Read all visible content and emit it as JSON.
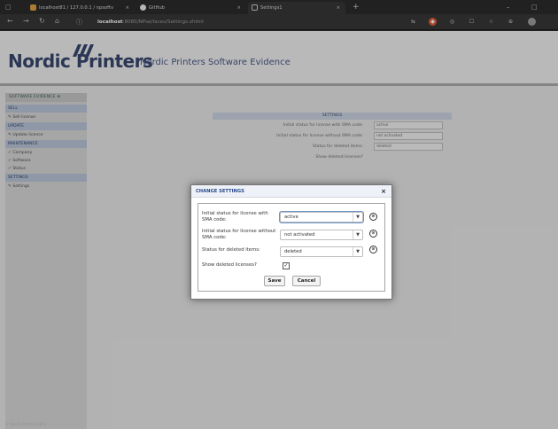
{
  "browser": {
    "tabs": [
      {
        "label": "localhost81 / 127.0.0.1 / npsoftv",
        "close": "×"
      },
      {
        "label": "GitHub",
        "close": "×"
      },
      {
        "label": "Settings1",
        "close": "×"
      }
    ],
    "new_tab": "+",
    "url_host": "localhost",
    "url_rest": ":8080/NPse/faces/Settings.xhtml",
    "controls": {
      "minimize": "–",
      "maximize": "□"
    }
  },
  "header": {
    "logo": "Nordic Printers",
    "app_title": "Nordic Printers Software Evidence"
  },
  "sidebar": {
    "toggle": "SOFTWARE EVIDENCE",
    "sections": [
      {
        "title": "SELL",
        "items": [
          "Sell license"
        ]
      },
      {
        "title": "UPDATE",
        "items": [
          "Update licence"
        ]
      },
      {
        "title": "MAINTENANCE",
        "items": [
          "Company",
          "Software",
          "Status"
        ]
      },
      {
        "title": "SETTINGS",
        "items": [
          "Settings"
        ]
      }
    ]
  },
  "background_form": {
    "title": "SETTINGS",
    "rows": [
      {
        "label": "Initial status for license with SMA code:",
        "value": "active"
      },
      {
        "label": "Initial status for license without SMA code:",
        "value": "not activated"
      },
      {
        "label": "Status for deleted items:",
        "value": "deleted"
      },
      {
        "label": "Show deleted licenses?",
        "value": ""
      }
    ]
  },
  "dialog": {
    "title": "CHANGE SETTINGS",
    "close": "×",
    "fields": [
      {
        "label": "Initial status for license with SMA code:",
        "value": "active"
      },
      {
        "label": "Initial status for license without SMA code:",
        "value": "not activated"
      },
      {
        "label": "Status for deleted items:",
        "value": "deleted"
      }
    ],
    "show_deleted_label": "Show deleted licenses?",
    "show_deleted_checked": true,
    "save_label": "Save",
    "cancel_label": "Cancel"
  },
  "footer": "© Nordic Printers 2016",
  "colors": {
    "brand": "#2b3c66",
    "accent": "#2a4a8c"
  }
}
